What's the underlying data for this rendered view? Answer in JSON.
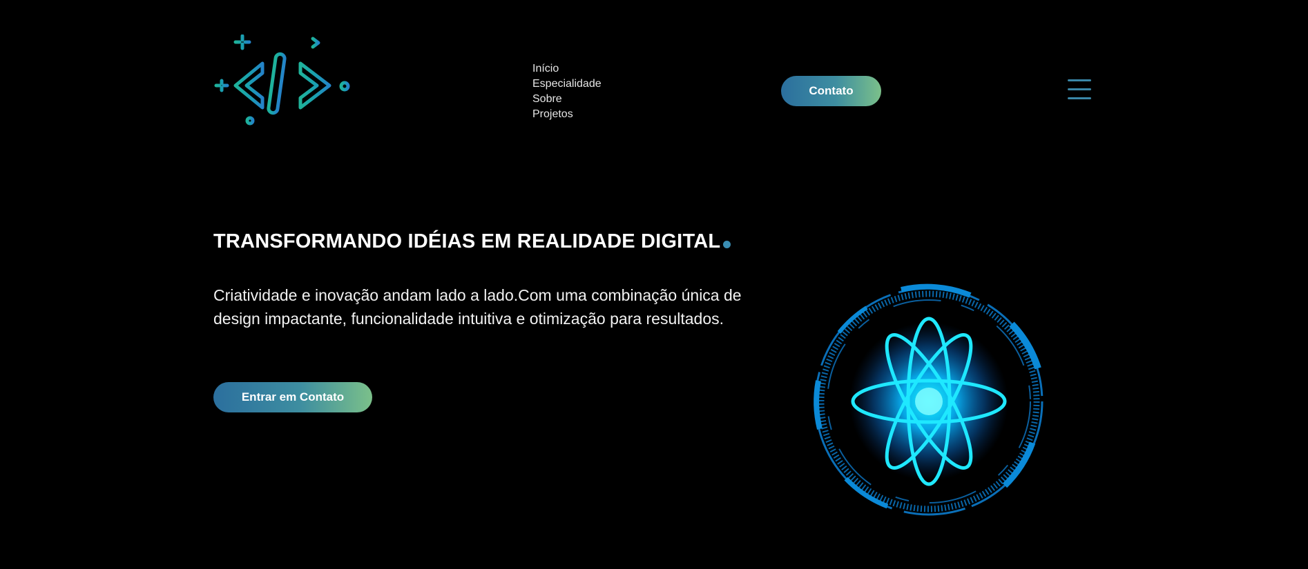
{
  "header": {
    "logo_icon": "code-brackets-logo",
    "nav": [
      {
        "label": "Início"
      },
      {
        "label": "Especialidade"
      },
      {
        "label": "Sobre"
      },
      {
        "label": "Projetos"
      }
    ],
    "contact_button": "Contato",
    "menu_icon": "hamburger-menu-icon"
  },
  "hero": {
    "title": "TRANSFORMANDO IDÉIAS EM REALIDADE DIGITAL",
    "description": "Criatividade e inovação andam lado a lado.Com uma combinação única de design impactante, funcionalidade intuitiva e otimização para resultados.",
    "cta_button": "Entrar em Contato",
    "illustration_icon": "atom-hud-icon"
  },
  "colors": {
    "background": "#000000",
    "accent_blue": "#2b6f9e",
    "accent_green": "#7bc08a",
    "atom_cyan": "#1fe8ff",
    "hud_blue": "#0a6fb8"
  }
}
